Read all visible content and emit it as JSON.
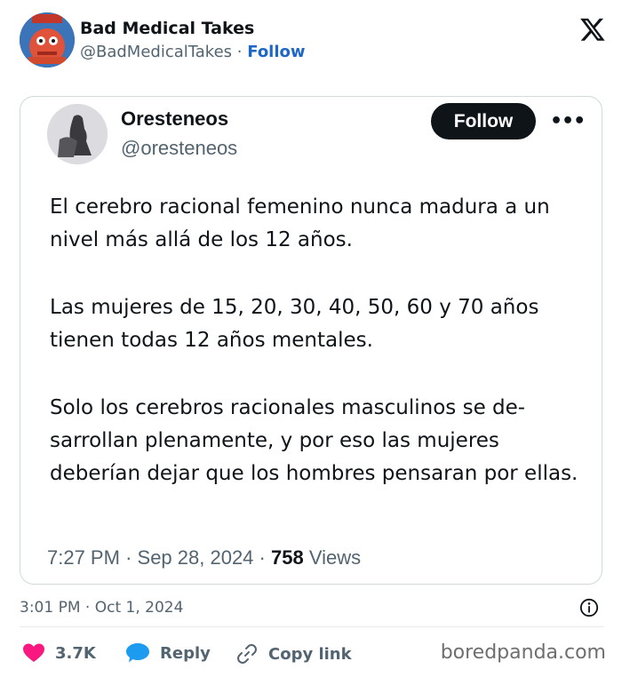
{
  "author": {
    "name": "Bad Medical Takes",
    "handle": "@BadMedicalTakes",
    "separator": "·",
    "follow_label": "Follow",
    "avatar_caption_top": "TRUST ME,",
    "avatar_caption_bottom": "I'M A DOCTOR"
  },
  "quoted_tweet": {
    "name": "Oresteneos",
    "handle": "@oresteneos",
    "follow_label": "Follow",
    "more_label": "•••",
    "paragraphs": [
      "El cerebro racional femenino nunca madura a un nivel más allá de los 12 años.",
      "Las mujeres de 15, 20, 30, 40, 50, 60 y 70 años tienen todas 12 años mentales.",
      "Solo los cerebros racionales masculinos se de-sarrollan plenamente, y por eso las mujeres deberían dejar que los hombres pensaran por ellas."
    ],
    "time": "7:27 PM",
    "date": "Sep 28, 2024",
    "views_count": "758",
    "views_label": "Views"
  },
  "post": {
    "time": "3:01 PM",
    "date": "Oct 1, 2024"
  },
  "actions": {
    "likes": "3.7K",
    "reply_label": "Reply",
    "copy_label": "Copy link"
  },
  "watermark": "boredpanda.com",
  "colors": {
    "like": "#f91880",
    "reply": "#1d9bf0",
    "follow_link": "#1d67c6",
    "follow_button": "#0f1419"
  },
  "icons": [
    "x-logo-icon",
    "more-icon",
    "info-icon",
    "heart-icon",
    "reply-bubble-icon",
    "link-icon"
  ]
}
